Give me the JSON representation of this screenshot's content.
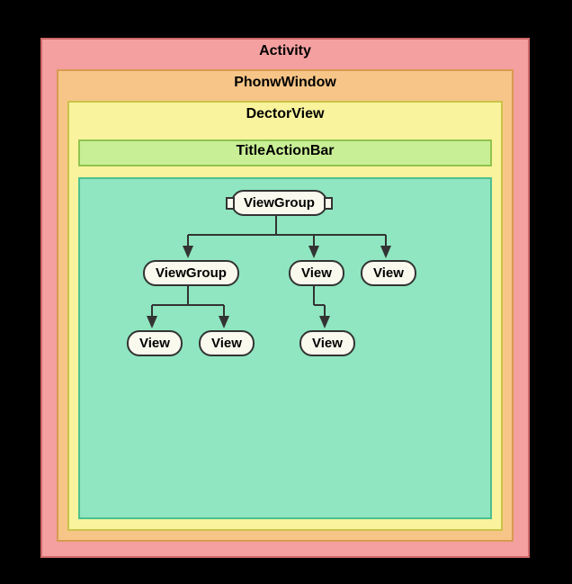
{
  "layers": {
    "activity": "Activity",
    "phonewindow": "PhonwWindow",
    "dectorview": "DectorView",
    "titlebar": "TitleActionBar"
  },
  "nodes": {
    "root": "ViewGroup",
    "child_group": "ViewGroup",
    "child_view1": "View",
    "child_view2": "View",
    "leaf1": "View",
    "leaf2": "View",
    "leaf3": "View"
  },
  "colors": {
    "activity_bg": "#f4a0a0",
    "phonewindow_bg": "#f6c587",
    "dectorview_bg": "#f9f39d",
    "titlebar_bg": "#c9ef96",
    "content_bg": "#8fe6c0"
  },
  "structure": {
    "description": "Android View hierarchy diagram showing Activity containing PhoneWindow containing DecorView which holds TitleActionBar and a content area with a ViewGroup tree",
    "tree": {
      "name": "ViewGroup",
      "children": [
        {
          "name": "ViewGroup",
          "children": [
            {
              "name": "View"
            },
            {
              "name": "View"
            }
          ]
        },
        {
          "name": "View",
          "children": [
            {
              "name": "View"
            }
          ]
        },
        {
          "name": "View"
        }
      ]
    }
  }
}
